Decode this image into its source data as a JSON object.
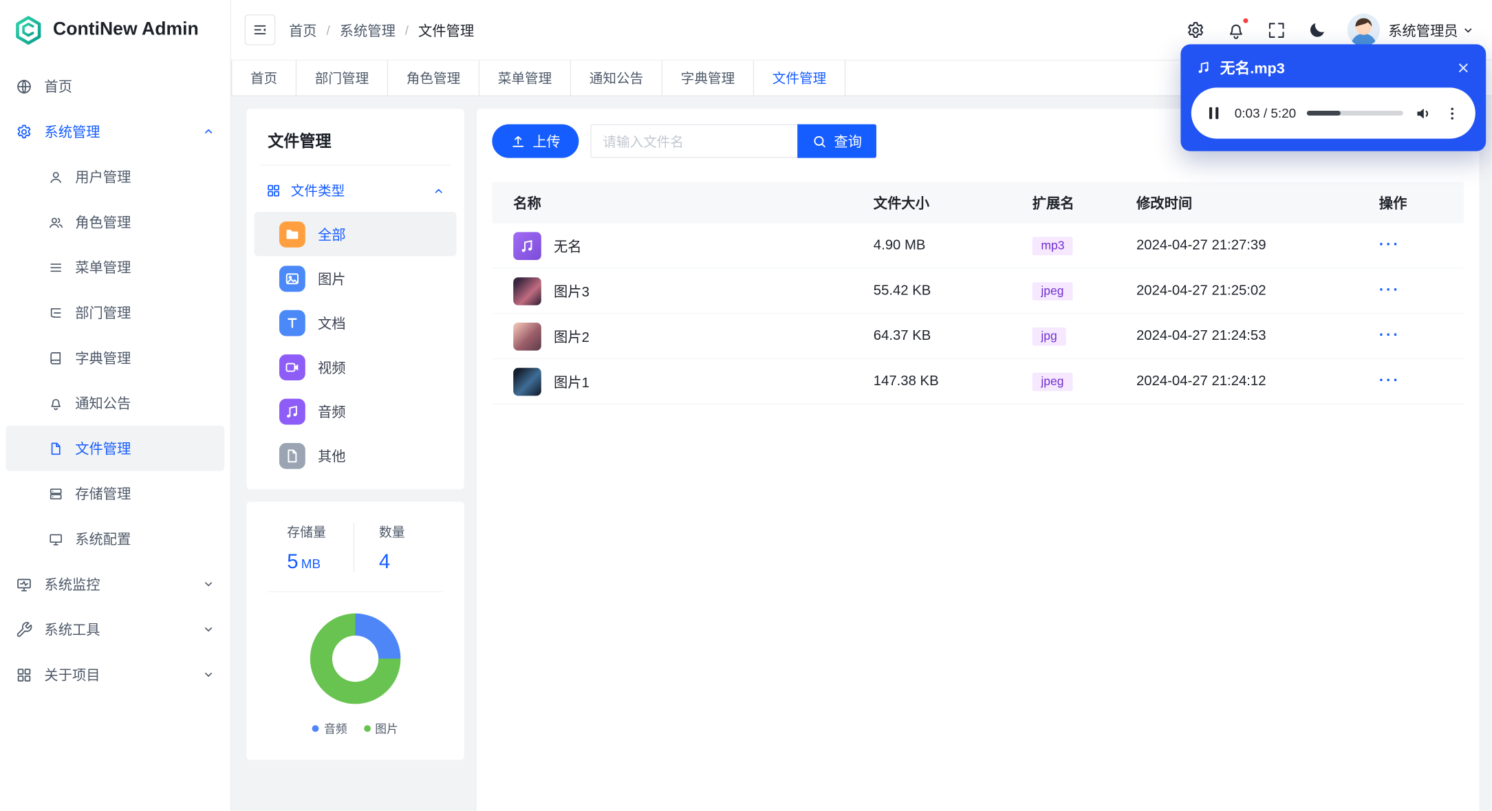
{
  "app": {
    "brand": "ContiNew Admin"
  },
  "topbar": {
    "breadcrumb": [
      "首页",
      "系统管理",
      "文件管理"
    ],
    "separator": "/",
    "username": "系统管理员"
  },
  "tabs": [
    "首页",
    "部门管理",
    "角色管理",
    "菜单管理",
    "通知公告",
    "字典管理",
    "文件管理"
  ],
  "active_tab": "文件管理",
  "sidebar": {
    "items": [
      {
        "label": "首页",
        "icon": "globe-icon"
      },
      {
        "label": "系统管理",
        "icon": "gear-icon",
        "expanded": true
      },
      {
        "label": "系统监控",
        "icon": "monitor-icon",
        "expanded": false
      },
      {
        "label": "系统工具",
        "icon": "wrench-icon",
        "expanded": false
      },
      {
        "label": "关于项目",
        "icon": "grid-icon",
        "expanded": false
      }
    ],
    "system_children": [
      {
        "label": "用户管理",
        "icon": "user-icon"
      },
      {
        "label": "角色管理",
        "icon": "users-icon"
      },
      {
        "label": "菜单管理",
        "icon": "menu-list-icon"
      },
      {
        "label": "部门管理",
        "icon": "tree-icon"
      },
      {
        "label": "字典管理",
        "icon": "book-icon"
      },
      {
        "label": "通知公告",
        "icon": "bell-icon"
      },
      {
        "label": "文件管理",
        "icon": "file-icon",
        "active": true
      },
      {
        "label": "存储管理",
        "icon": "storage-icon"
      },
      {
        "label": "系统配置",
        "icon": "desktop-icon"
      }
    ]
  },
  "file_panel": {
    "title": "文件管理",
    "group_label": "文件类型",
    "types": [
      {
        "label": "全部",
        "icon": "folder-icon",
        "color": "#ff9f40",
        "active": true
      },
      {
        "label": "图片",
        "icon": "image-icon",
        "color": "#4a89f7",
        "active": false
      },
      {
        "label": "文档",
        "icon": "document-icon",
        "color": "#4a89f7",
        "active": false
      },
      {
        "label": "视频",
        "icon": "video-icon",
        "color": "#8e5cf6",
        "active": false
      },
      {
        "label": "音频",
        "icon": "audio-icon",
        "color": "#8e5cf6",
        "active": false
      },
      {
        "label": "其他",
        "icon": "other-file-icon",
        "color": "#9aa4b2",
        "active": false
      }
    ]
  },
  "stats": {
    "storage_label": "存储量",
    "storage_value": "5",
    "storage_unit": "MB",
    "count_label": "数量",
    "count_value": "4"
  },
  "chart_data": {
    "type": "pie",
    "donut": true,
    "categories": [
      "音频",
      "图片"
    ],
    "values": [
      1,
      3
    ],
    "colors": [
      "#4e86f7",
      "#69c350"
    ],
    "legend_position": "bottom"
  },
  "toolbar": {
    "upload_label": "上传",
    "search_placeholder": "请输入文件名",
    "query_label": "查询"
  },
  "table": {
    "headers": [
      "名称",
      "文件大小",
      "扩展名",
      "修改时间",
      "操作"
    ],
    "rows": [
      {
        "name": "无名",
        "size": "4.90 MB",
        "ext": "mp3",
        "time": "2024-04-27 21:27:39"
      },
      {
        "name": "图片3",
        "size": "55.42 KB",
        "ext": "jpeg",
        "time": "2024-04-27 21:25:02"
      },
      {
        "name": "图片2",
        "size": "64.37 KB",
        "ext": "jpg",
        "time": "2024-04-27 21:24:53"
      },
      {
        "name": "图片1",
        "size": "147.38 KB",
        "ext": "jpeg",
        "time": "2024-04-27 21:24:12"
      }
    ],
    "actions_label": "···"
  },
  "player": {
    "title": "无名.mp3",
    "current_time": "0:03",
    "duration": "5:20",
    "time_display": "0:03 / 5:20",
    "progress_percent": 35
  },
  "colors": {
    "primary": "#165DFF",
    "player_bg": "#2254F4",
    "tag_bg": "#F5E8FF",
    "tag_text": "#722ED1",
    "badge_red": "#F53F3F"
  }
}
